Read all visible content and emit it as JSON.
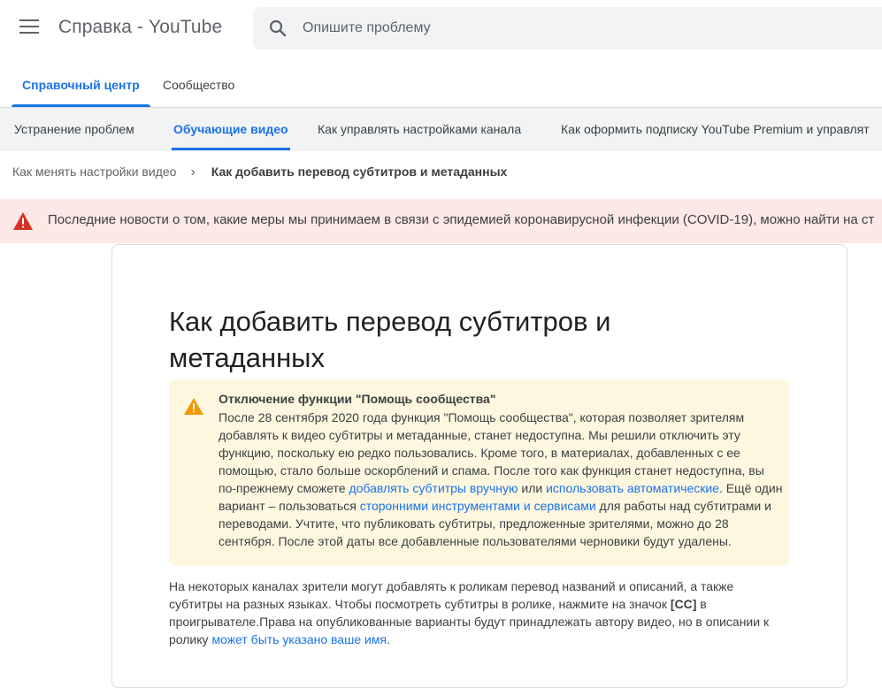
{
  "header": {
    "title": "Справка - YouTube",
    "search_placeholder": "Опишите проблему"
  },
  "main_tabs": [
    {
      "label": "Справочный центр",
      "active": true
    },
    {
      "label": "Сообщество",
      "active": false
    }
  ],
  "sub_tabs": [
    {
      "label": "Устранение проблем",
      "active": false
    },
    {
      "label": "Обучающие видео",
      "active": true
    },
    {
      "label": "Как управлять настройками канала",
      "active": false
    },
    {
      "label": "Как оформить подписку YouTube Premium и управлят",
      "active": false
    }
  ],
  "breadcrumb": {
    "parent": "Как менять настройки видео",
    "separator": "›",
    "current": "Как добавить перевод субтитров и метаданных"
  },
  "banner": {
    "text": "Последние новости о том, какие меры мы принимаем в связи с эпидемией коронавирусной инфекции (COVID-19), можно найти на ст"
  },
  "article": {
    "title": "Как добавить перевод субтитров и метаданных",
    "notice": {
      "title": "Отключение функции \"Помощь сообщества\"",
      "text1": "После 28 сентября 2020 года функция \"Помощь сообщества\", которая позволяет зрителям добавлять к видео субтитры и метаданные, станет недоступна. Мы решили отключить эту функцию, поскольку ею редко пользовались. Кроме того, в материалах, добавленных с ее помощью, стало больше оскорблений и спама. После того как функция станет недоступна, вы по-прежнему сможете ",
      "link1": "добавлять субтитры вручную",
      "text2": " или ",
      "link2": "использовать автоматические",
      "text3": ". Ещё один вариант – пользоваться ",
      "link3": "сторонними инструментами и сервисами",
      "text4": " для работы над субтитрами и переводами. Учтите, что публиковать субтитры, предложенные зрителями, можно до 28 сентября. После этой даты все добавленные пользователями черновики будут удалены."
    },
    "para1": {
      "text1": "На некоторых каналах зрители могут добавлять к роликам перевод названий и описаний, а также субтитры на разных языках. Чтобы посмотреть субтитры в ролике, нажмите на значок ",
      "cc": "[CC]",
      "text2": " в проигрывателе.Права на опубликованные варианты будут принадлежать автору видео, но в описании к ролику ",
      "link": "может быть указано ваше имя",
      "text3": "."
    }
  },
  "colors": {
    "accent": "#1a73e8",
    "banner_bg": "#fce8e6",
    "banner_icon": "#d93025",
    "notice_bg": "#fef7e0",
    "notice_icon": "#f29900"
  },
  "icons": {
    "menu": "menu-icon",
    "search": "search-icon",
    "breadcrumb_sep": "chevron-right-icon",
    "banner": "warning-icon",
    "notice": "warning-icon"
  }
}
